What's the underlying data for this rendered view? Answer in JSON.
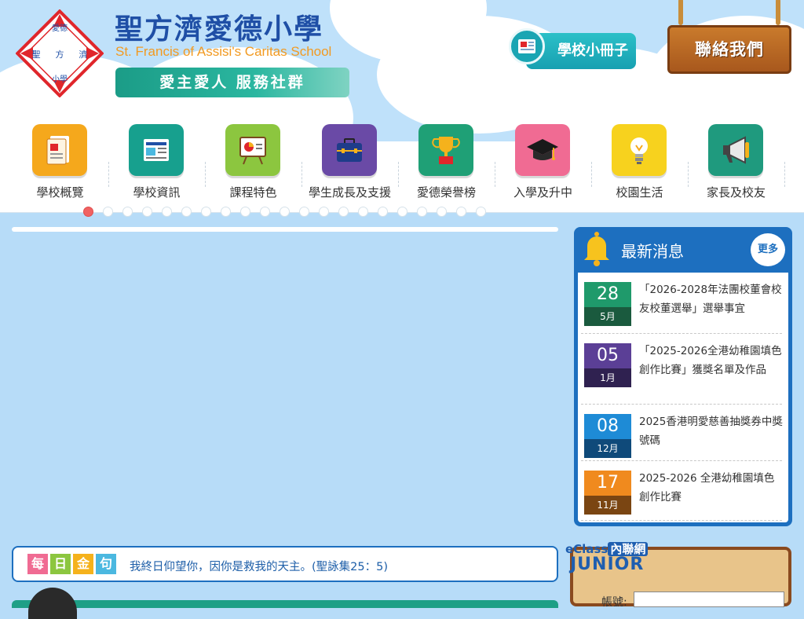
{
  "school": {
    "name_zh": "聖方濟愛德小學",
    "name_en": "St. Francis of Assisi's Caritas School",
    "motto": "愛主愛人  服務社群",
    "logo_text": [
      "愛德",
      "聖",
      "方",
      "濟",
      "小學"
    ]
  },
  "header": {
    "booklet_label": "學校小冊子",
    "contact_label": "聯絡我們"
  },
  "nav": {
    "items": [
      {
        "label": "學校概覽",
        "color": "#f5a81c",
        "icon": "document-icon"
      },
      {
        "label": "學校資訊",
        "color": "#17a08e",
        "icon": "newspaper-icon"
      },
      {
        "label": "課程特色",
        "color": "#8cc63f",
        "icon": "presentation-board-icon"
      },
      {
        "label": "學生成長及支援",
        "color": "#6a4aa6",
        "icon": "briefcase-icon"
      },
      {
        "label": "愛德榮譽榜",
        "color": "#1fa076",
        "icon": "trophy-icon"
      },
      {
        "label": "入學及升中",
        "color": "#f06b93",
        "icon": "graduation-cap-icon"
      },
      {
        "label": "校園生活",
        "color": "#f7d21e",
        "icon": "lightbulb-icon"
      },
      {
        "label": "家長及校友",
        "color": "#1f9a7e",
        "icon": "megaphone-icon"
      }
    ]
  },
  "slider": {
    "dot_count": 21,
    "active_index": 0
  },
  "news": {
    "title": "最新消息",
    "more_label": "更多",
    "items": [
      {
        "day": "28",
        "month": "5月",
        "text": "「2026-2028年法團校董會校友校董選舉」選舉事宜",
        "day_color": "#1f9a6b",
        "month_color": "#1a5a3e"
      },
      {
        "day": "05",
        "month": "1月",
        "text": "「2025-2026全港幼稚園填色創作比賽」獲獎名單及作品",
        "day_color": "#5b3f96",
        "month_color": "#2f2150"
      },
      {
        "day": "08",
        "month": "12月",
        "text": "2025香港明愛慈善抽獎券中獎號碼",
        "day_color": "#1e8bd6",
        "month_color": "#0f4a7a"
      },
      {
        "day": "17",
        "month": "11月",
        "text": "2025-2026 全港幼稚園填色創作比賽",
        "day_color": "#f08a1e",
        "month_color": "#7a4512"
      }
    ]
  },
  "daily": {
    "badges": [
      "每",
      "日",
      "金",
      "句"
    ],
    "badge_colors": [
      "#f06b93",
      "#8cc63f",
      "#f5b21c",
      "#4bb8e0"
    ],
    "verse": "我終日仰望你，因你是救我的天主。(聖詠集25：5)"
  },
  "eclass": {
    "brand": "eClass",
    "brand_suffix": "內聯網",
    "junior": "JUNIOR",
    "account_label": "帳號:"
  }
}
